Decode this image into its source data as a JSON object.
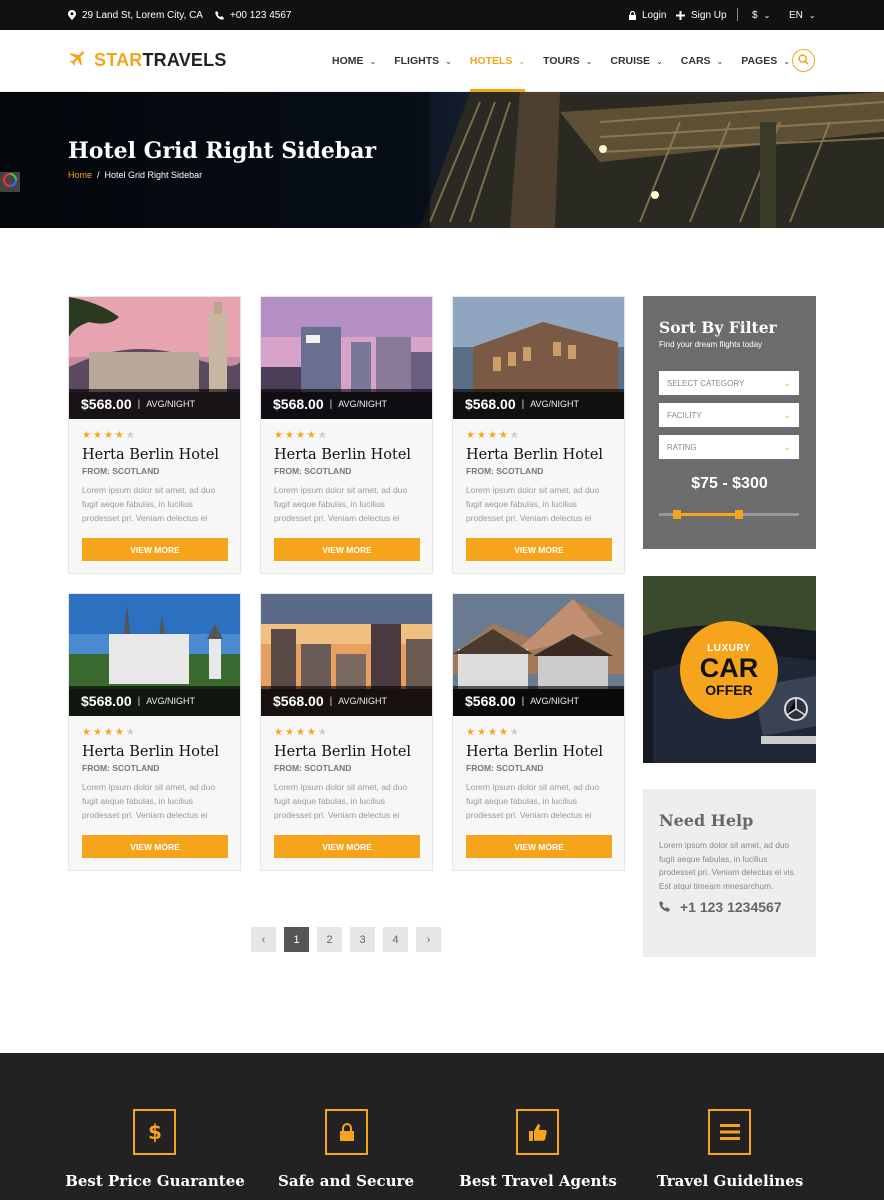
{
  "topbar": {
    "address": "29 Land St, Lorem City, CA",
    "phone": "+00 123 4567",
    "login": "Login",
    "signup": "Sign Up",
    "currency": "$",
    "language": "EN"
  },
  "brand": {
    "star": "STAR",
    "travels": "TRAVELS"
  },
  "nav": {
    "items": [
      {
        "label": "HOME"
      },
      {
        "label": "FLIGHTS"
      },
      {
        "label": "HOTELS"
      },
      {
        "label": "TOURS"
      },
      {
        "label": "CRUISE"
      },
      {
        "label": "CARS"
      },
      {
        "label": "PAGES"
      }
    ],
    "active": "HOTELS"
  },
  "hero": {
    "title": "Hotel Grid Right Sidebar",
    "breadcrumb_home": "Home",
    "breadcrumb_sep": "/",
    "breadcrumb_current": "Hotel Grid Right Sidebar"
  },
  "hotels": [
    {
      "price": "$568.00",
      "unit": "AVG/NIGHT",
      "rating": 4,
      "name": "Herta Berlin Hotel",
      "from": "FROM: SCOTLAND",
      "desc": "Lorem ipsum dolor sit amet, ad duo fugit aeque fabulas, in lucilius prodesset pri. Veniam delectus ei",
      "button": "VIEW MORE"
    },
    {
      "price": "$568.00",
      "unit": "AVG/NIGHT",
      "rating": 4,
      "name": "Herta Berlin Hotel",
      "from": "FROM: SCOTLAND",
      "desc": "Lorem ipsum dolor sit amet, ad duo fugit aeque fabulas, in lucilius prodesset pri. Veniam delectus ei",
      "button": "VIEW MORE"
    },
    {
      "price": "$568.00",
      "unit": "AVG/NIGHT",
      "rating": 4,
      "name": "Herta Berlin Hotel",
      "from": "FROM: SCOTLAND",
      "desc": "Lorem ipsum dolor sit amet, ad duo fugit aeque fabulas, in lucilius prodesset pri. Veniam delectus ei",
      "button": "VIEW MORE"
    },
    {
      "price": "$568.00",
      "unit": "AVG/NIGHT",
      "rating": 4,
      "name": "Herta Berlin Hotel",
      "from": "FROM: SCOTLAND",
      "desc": "Lorem ipsum dolor sit amet, ad duo fugit aeque fabulas, in lucilius prodesset pri. Veniam delectus ei",
      "button": "VIEW MORE"
    },
    {
      "price": "$568.00",
      "unit": "AVG/NIGHT",
      "rating": 4,
      "name": "Herta Berlin Hotel",
      "from": "FROM: SCOTLAND",
      "desc": "Lorem ipsum dolor sit amet, ad duo fugit aeque fabulas, in lucilius prodesset pri. Veniam delectus ei",
      "button": "VIEW MORE"
    },
    {
      "price": "$568.00",
      "unit": "AVG/NIGHT",
      "rating": 4,
      "name": "Herta Berlin Hotel",
      "from": "FROM: SCOTLAND",
      "desc": "Lorem ipsum dolor sit amet, ad duo fugit aeque fabulas, in lucilius prodesset pri. Veniam delectus ei",
      "button": "VIEW MORE"
    }
  ],
  "pagination": {
    "prev": "‹",
    "pages": [
      "1",
      "2",
      "3",
      "4"
    ],
    "current": "1",
    "next": "›"
  },
  "filter": {
    "title": "Sort By Filter",
    "subtitle": "Find your dream flights today",
    "selects": [
      "SELECT CATEGORY",
      "FACILITY",
      "RATING"
    ],
    "price_range": "$75 - $300",
    "slider_low": 0.13,
    "slider_high": 0.57
  },
  "offer": {
    "line1": "LUXURY",
    "line2": "CAR",
    "line3": "OFFER"
  },
  "help": {
    "title": "Need Help",
    "text": "Lorem ipsum dolor sit amet, ad duo fugit aeque fabulas, in lucilius prodesset pri. Veniam delectus ei vis. Est atqui timeam mnesarchum.",
    "phone": "+1 123 1234567"
  },
  "features": [
    {
      "title": "Best Price Guarantee",
      "icon": "dollar-icon"
    },
    {
      "title": "Safe and Secure",
      "icon": "lock-icon"
    },
    {
      "title": "Best Travel Agents",
      "icon": "thumbs-up-icon"
    },
    {
      "title": "Travel Guidelines",
      "icon": "list-icon"
    }
  ],
  "colors": {
    "accent": "#f6a41b",
    "dark": "#111111",
    "footer": "#222222",
    "filter_bg": "#6c6c6c"
  }
}
